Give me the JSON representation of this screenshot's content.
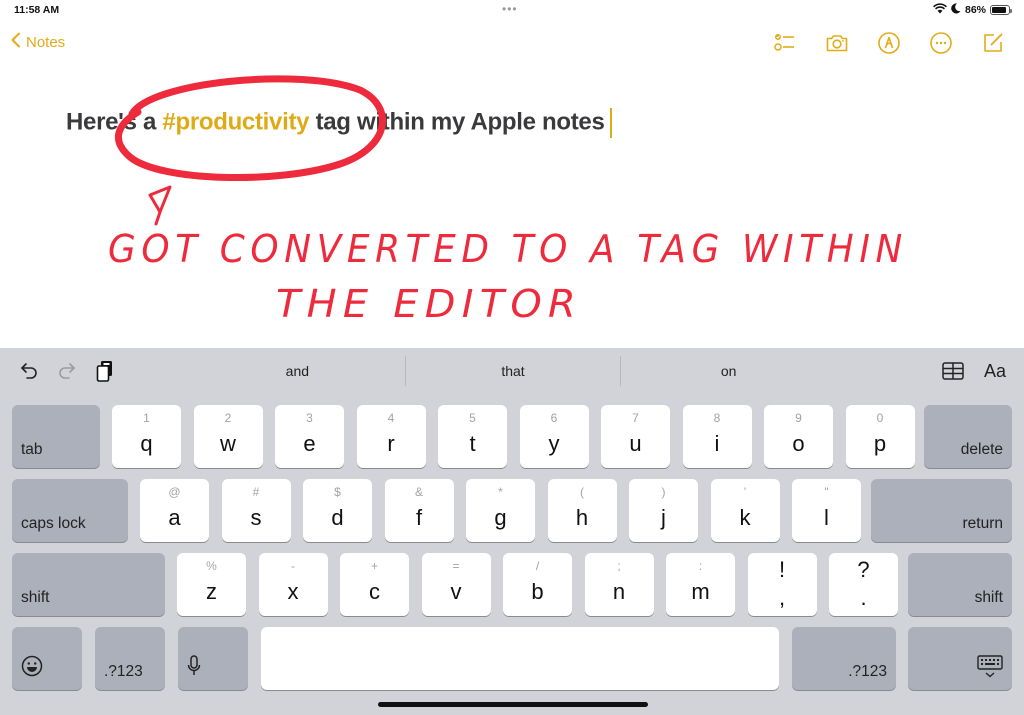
{
  "status_bar": {
    "time": "11:58 AM",
    "battery_percent": "86%",
    "battery_level": 0.86,
    "icons": [
      "wifi-icon",
      "moon-icon",
      "battery-icon"
    ]
  },
  "nav": {
    "back_label": "Notes",
    "accent_color": "#e3ab17",
    "toolbar_icons": [
      "checklist-icon",
      "camera-icon",
      "markup-pen-icon",
      "more-icon",
      "compose-icon"
    ]
  },
  "note": {
    "text_before": "Here's a ",
    "tag": "#productivity",
    "text_after": " tag within my Apple notes",
    "tag_color": "#deaa16",
    "annotation_line1": "GOT CONVERTED TO A TAG WITHIN",
    "annotation_line2": "THE EDITOR",
    "annotation_color": "#ee2b3c"
  },
  "keyboard": {
    "shortcut_bar": {
      "left_icons": [
        "undo-icon",
        "redo-icon",
        "paste-icon"
      ],
      "suggestions": [
        "and",
        "that",
        "on"
      ],
      "right_icons": [
        "table-icon",
        "format-text-icon"
      ],
      "format_label": "Aa"
    },
    "row1": {
      "tab": "tab",
      "keys": [
        {
          "hint": "1",
          "key": "q"
        },
        {
          "hint": "2",
          "key": "w"
        },
        {
          "hint": "3",
          "key": "e"
        },
        {
          "hint": "4",
          "key": "r"
        },
        {
          "hint": "5",
          "key": "t"
        },
        {
          "hint": "6",
          "key": "y"
        },
        {
          "hint": "7",
          "key": "u"
        },
        {
          "hint": "8",
          "key": "i"
        },
        {
          "hint": "9",
          "key": "o"
        },
        {
          "hint": "0",
          "key": "p"
        }
      ],
      "delete": "delete"
    },
    "row2": {
      "caps": "caps lock",
      "keys": [
        {
          "hint": "@",
          "key": "a"
        },
        {
          "hint": "#",
          "key": "s"
        },
        {
          "hint": "$",
          "key": "d"
        },
        {
          "hint": "&",
          "key": "f"
        },
        {
          "hint": "*",
          "key": "g"
        },
        {
          "hint": "(",
          "key": "h"
        },
        {
          "hint": ")",
          "key": "j"
        },
        {
          "hint": "’",
          "key": "k"
        },
        {
          "hint": "\"",
          "key": "l"
        }
      ],
      "return": "return"
    },
    "row3": {
      "shift": "shift",
      "keys": [
        {
          "hint": "%",
          "key": "z"
        },
        {
          "hint": "-",
          "key": "x"
        },
        {
          "hint": "+",
          "key": "c"
        },
        {
          "hint": "=",
          "key": "v"
        },
        {
          "hint": "/",
          "key": "b"
        },
        {
          "hint": ";",
          "key": "n"
        },
        {
          "hint": ":",
          "key": "m"
        }
      ],
      "punct": [
        {
          "hint": "!",
          "key": ","
        },
        {
          "hint": "?",
          "key": "."
        }
      ],
      "shift_right": "shift"
    },
    "row4": {
      "numbers_left": ".?123",
      "numbers_right": ".?123",
      "icons": [
        "emoji-icon",
        "microphone-icon",
        "dismiss-keyboard-icon"
      ]
    }
  }
}
